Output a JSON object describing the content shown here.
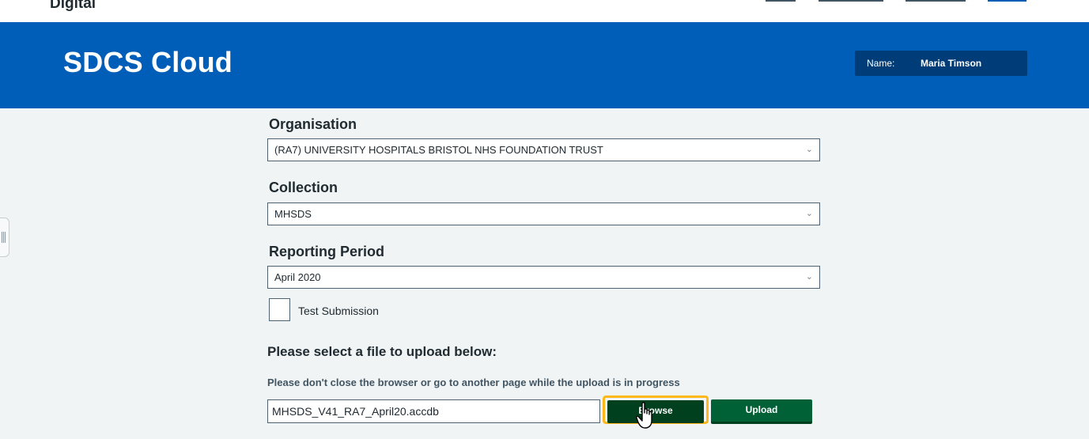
{
  "brand": {
    "text": "Digital"
  },
  "header": {
    "title": "SDCS Cloud",
    "user_label": "Name:",
    "user_name": "Maria Timson"
  },
  "form": {
    "organisation": {
      "label": "Organisation",
      "selected": "(RA7) UNIVERSITY HOSPITALS BRISTOL NHS FOUNDATION TRUST"
    },
    "collection": {
      "label": "Collection",
      "selected": "MHSDS"
    },
    "reporting_period": {
      "label": "Reporting Period",
      "selected": "April 2020"
    },
    "test_submission": {
      "label": "Test Submission",
      "checked": false
    },
    "upload": {
      "heading": "Please select a file to upload below:",
      "note": "Please don't close the browser or go to another page while the upload is in progress",
      "file_value": "MHSDS_V41_RA7_April20.accdb",
      "browse_label": "Browse",
      "upload_label": "Upload"
    }
  },
  "colors": {
    "header_blue": "#005eb8",
    "user_box": "#003d78",
    "button_green": "#006136",
    "focus_yellow": "#ffb81c"
  },
  "icons": {
    "dropdown": "chevron-down-icon",
    "cursor": "hand-pointer-icon",
    "side_tab": "grip-icon"
  }
}
